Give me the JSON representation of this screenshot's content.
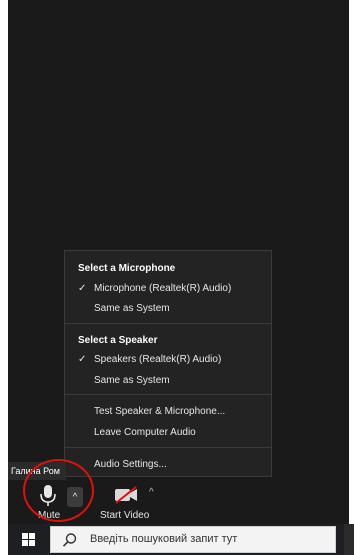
{
  "audio_menu": {
    "microphone_heading": "Select a Microphone",
    "mic_selected": "Microphone (Realtek(R) Audio)",
    "mic_same_as_system": "Same as System",
    "speaker_heading": "Select a Speaker",
    "speaker_selected": "Speakers (Realtek(R) Audio)",
    "speaker_same_as_system": "Same as System",
    "test_speaker_mic": "Test Speaker & Microphone...",
    "leave_computer_audio": "Leave Computer Audio",
    "audio_settings": "Audio Settings..."
  },
  "participant": {
    "name": "Галина Ром"
  },
  "toolbar": {
    "mute_label": "Mute",
    "start_video_label": "Start Video"
  },
  "taskbar": {
    "search_placeholder": "Введіть пошуковий запит тут"
  },
  "icons": [
    "microphone-icon",
    "video-off-icon",
    "chevron-up-icon",
    "windows-icon",
    "search-icon",
    "check-icon"
  ],
  "colors": {
    "background": "#1a1a1a",
    "menu_background": "#232323",
    "highlight_circle": "#e01010",
    "taskbar": "#1e1f22"
  }
}
